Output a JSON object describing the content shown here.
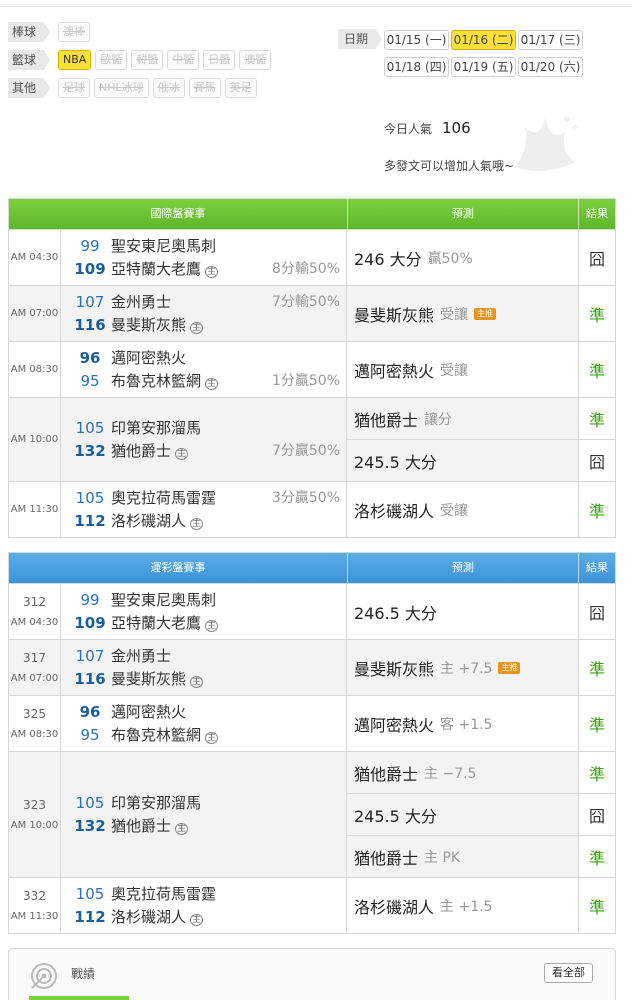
{
  "filters": {
    "rows": [
      {
        "label": "棒球",
        "chips": [
          {
            "text": "澳棒",
            "active": false
          }
        ]
      },
      {
        "label": "籃球",
        "chips": [
          {
            "text": "NBA",
            "active": true
          },
          {
            "text": "歐籃",
            "active": false
          },
          {
            "text": "韓籃",
            "active": false
          },
          {
            "text": "中籃",
            "active": false
          },
          {
            "text": "日籃",
            "active": false
          },
          {
            "text": "澳籃",
            "active": false
          }
        ]
      },
      {
        "label": "其他",
        "chips": [
          {
            "text": "足球",
            "active": false
          },
          {
            "text": "NHL冰球",
            "active": false
          },
          {
            "text": "俄冰",
            "active": false
          },
          {
            "text": "賽馬",
            "active": false
          },
          {
            "text": "美足",
            "active": false
          }
        ]
      }
    ],
    "date_label": "日期",
    "dates": [
      {
        "text": "01/15 (一)",
        "active": false
      },
      {
        "text": "01/16 (二)",
        "active": true
      },
      {
        "text": "01/17 (三)",
        "active": false
      },
      {
        "text": "01/18 (四)",
        "active": false
      },
      {
        "text": "01/19 (五)",
        "active": false
      },
      {
        "text": "01/20 (六)",
        "active": false
      }
    ]
  },
  "popularity": {
    "label": "今日人氣",
    "value": "106",
    "hint": "多發文可以增加人氣哦~"
  },
  "intl": {
    "header": {
      "match": "國際盤賽事",
      "predict": "預測",
      "result": "結果"
    },
    "games": [
      {
        "id": "",
        "time": "AM 04:30",
        "away_score": "99",
        "away": "聖安東尼奧馬刺",
        "home_score": "109",
        "home": "亞特蘭大老鷹",
        "home_mark": "主",
        "away_win": false,
        "spread": "8分輸50%",
        "spread_row": 2,
        "preds": [
          {
            "main": "246 大分",
            "sub": "贏50%",
            "badge": "",
            "result": "囧",
            "hit": false
          }
        ]
      },
      {
        "id": "",
        "time": "AM 07:00",
        "away_score": "107",
        "away": "金州勇士",
        "home_score": "116",
        "home": "曼斐斯灰熊",
        "home_mark": "主",
        "away_win": false,
        "spread": "7分輸50%",
        "spread_row": 1,
        "preds": [
          {
            "main": "曼斐斯灰熊",
            "sub": "受讓",
            "badge": "主推",
            "result": "準",
            "hit": true
          }
        ]
      },
      {
        "id": "",
        "time": "AM 08:30",
        "away_score": "96",
        "away": "邁阿密熱火",
        "home_score": "95",
        "home": "布魯克林籃網",
        "home_mark": "主",
        "away_win": true,
        "spread": "1分贏50%",
        "spread_row": 2,
        "preds": [
          {
            "main": "邁阿密熱火",
            "sub": "受讓",
            "badge": "",
            "result": "準",
            "hit": true
          }
        ]
      },
      {
        "id": "",
        "time": "AM 10:00",
        "away_score": "105",
        "away": "印第安那溜馬",
        "home_score": "132",
        "home": "猶他爵士",
        "home_mark": "主",
        "away_win": false,
        "spread": "7分贏50%",
        "spread_row": 2,
        "preds": [
          {
            "main": "猶他爵士",
            "sub": "讓分",
            "badge": "",
            "result": "準",
            "hit": true
          },
          {
            "main": "245.5 大分",
            "sub": "",
            "badge": "",
            "result": "囧",
            "hit": false
          }
        ]
      },
      {
        "id": "",
        "time": "AM 11:30",
        "away_score": "105",
        "away": "奧克拉荷馬雷霆",
        "home_score": "112",
        "home": "洛杉磯湖人",
        "home_mark": "主",
        "away_win": false,
        "spread": "3分贏50%",
        "spread_row": 1,
        "preds": [
          {
            "main": "洛杉磯湖人",
            "sub": "受讓",
            "badge": "",
            "result": "準",
            "hit": true
          }
        ]
      }
    ]
  },
  "lottery": {
    "header": {
      "match": "運彩盤賽事",
      "predict": "預測",
      "result": "結果"
    },
    "games": [
      {
        "id": "312",
        "time": "AM 04:30",
        "away_score": "99",
        "away": "聖安東尼奧馬刺",
        "home_score": "109",
        "home": "亞特蘭大老鷹",
        "home_mark": "主",
        "away_win": false,
        "spread": "",
        "preds": [
          {
            "main": "246.5 大分",
            "sub": "",
            "badge": "",
            "result": "囧",
            "hit": false
          }
        ]
      },
      {
        "id": "317",
        "time": "AM 07:00",
        "away_score": "107",
        "away": "金州勇士",
        "home_score": "116",
        "home": "曼斐斯灰熊",
        "home_mark": "主",
        "away_win": false,
        "spread": "",
        "preds": [
          {
            "main": "曼斐斯灰熊",
            "sub": "主 +7.5",
            "badge": "主推",
            "result": "準",
            "hit": true
          }
        ]
      },
      {
        "id": "325",
        "time": "AM 08:30",
        "away_score": "96",
        "away": "邁阿密熱火",
        "home_score": "95",
        "home": "布魯克林籃網",
        "home_mark": "主",
        "away_win": true,
        "spread": "",
        "preds": [
          {
            "main": "邁阿密熱火",
            "sub": "客 +1.5",
            "badge": "",
            "result": "準",
            "hit": true
          }
        ]
      },
      {
        "id": "323",
        "time": "AM 10:00",
        "away_score": "105",
        "away": "印第安那溜馬",
        "home_score": "132",
        "home": "猶他爵士",
        "home_mark": "主",
        "away_win": false,
        "spread": "",
        "preds": [
          {
            "main": "猶他爵士",
            "sub": "主 −7.5",
            "badge": "",
            "result": "準",
            "hit": true
          },
          {
            "main": "245.5 大分",
            "sub": "",
            "badge": "",
            "result": "囧",
            "hit": false
          },
          {
            "main": "猶他爵士",
            "sub": "主 PK",
            "badge": "",
            "result": "準",
            "hit": true
          }
        ]
      },
      {
        "id": "332",
        "time": "AM 11:30",
        "away_score": "105",
        "away": "奧克拉荷馬雷霆",
        "home_score": "112",
        "home": "洛杉磯湖人",
        "home_mark": "主",
        "away_win": false,
        "spread": "",
        "preds": [
          {
            "main": "洛杉磯湖人",
            "sub": "主 +1.5",
            "badge": "",
            "result": "準",
            "hit": true
          }
        ]
      }
    ]
  },
  "record": {
    "title": "戰績",
    "button": "看全部"
  },
  "colors": {
    "hit": "#3aa60f",
    "accent_yellow": "#ffdf3a",
    "intl_header": "#6cc236",
    "lottery_header": "#48a0df"
  }
}
